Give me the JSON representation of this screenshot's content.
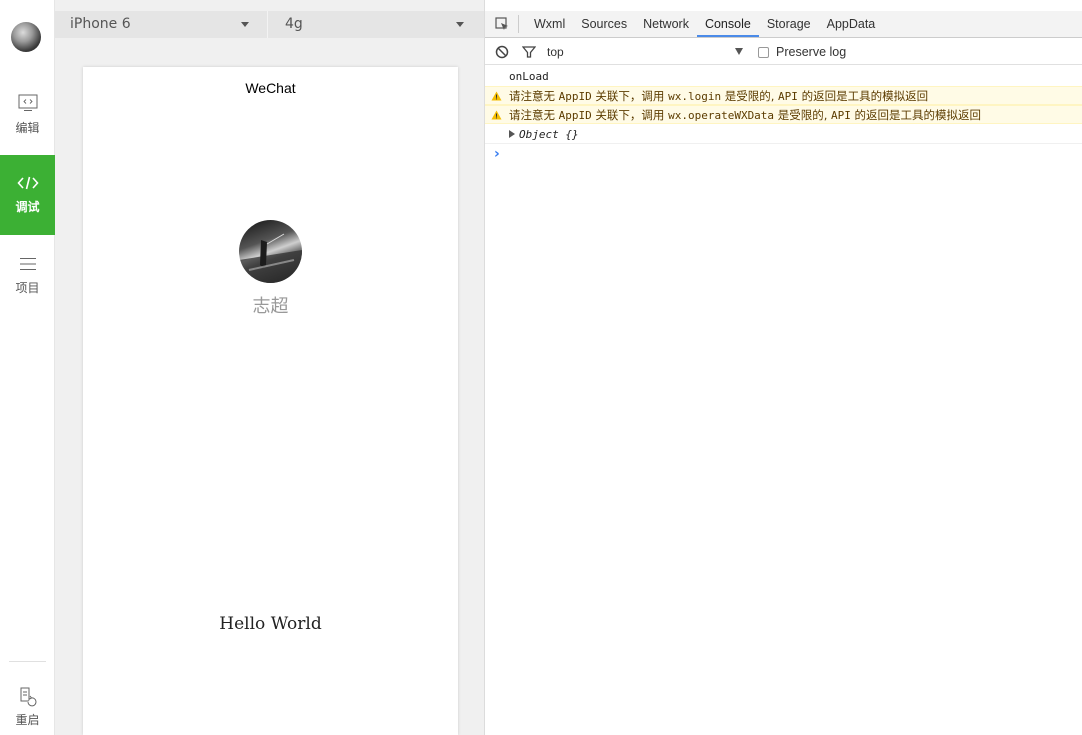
{
  "nav": {
    "items": [
      {
        "label": "编辑",
        "icon": "code-box-icon"
      },
      {
        "label": "调试",
        "icon": "code-brackets-icon",
        "active": true
      },
      {
        "label": "项目",
        "icon": "hamburger-icon"
      }
    ],
    "restart_label": "重启"
  },
  "simulator": {
    "device": "iPhone 6",
    "network": "4g",
    "page_title": "WeChat",
    "nickname": "志超",
    "hello": "Hello World"
  },
  "devtools": {
    "tabs": [
      "Wxml",
      "Sources",
      "Network",
      "Console",
      "Storage",
      "AppData"
    ],
    "active_tab": "Console",
    "context": "top",
    "preserve_log_label": "Preserve log",
    "logs": [
      {
        "type": "log",
        "text": "onLoad"
      },
      {
        "type": "warn",
        "parts": [
          "请注意无 ",
          "AppID",
          " 关联下，调用 ",
          "wx.login",
          " 是受限的, ",
          "API",
          " 的返回是工具的模拟返回"
        ]
      },
      {
        "type": "warn",
        "parts": [
          "请注意无 ",
          "AppID",
          " 关联下，调用 ",
          "wx.operateWXData",
          " 是受限的, ",
          "API",
          " 的返回是工具的模拟返回"
        ]
      },
      {
        "type": "object",
        "text": "Object {}"
      }
    ]
  },
  "colors": {
    "accent_green": "#3cb034",
    "active_tab_underline": "#4a8ae8",
    "warn_bg": "#fffbe6",
    "prompt_blue": "#367cf1"
  }
}
